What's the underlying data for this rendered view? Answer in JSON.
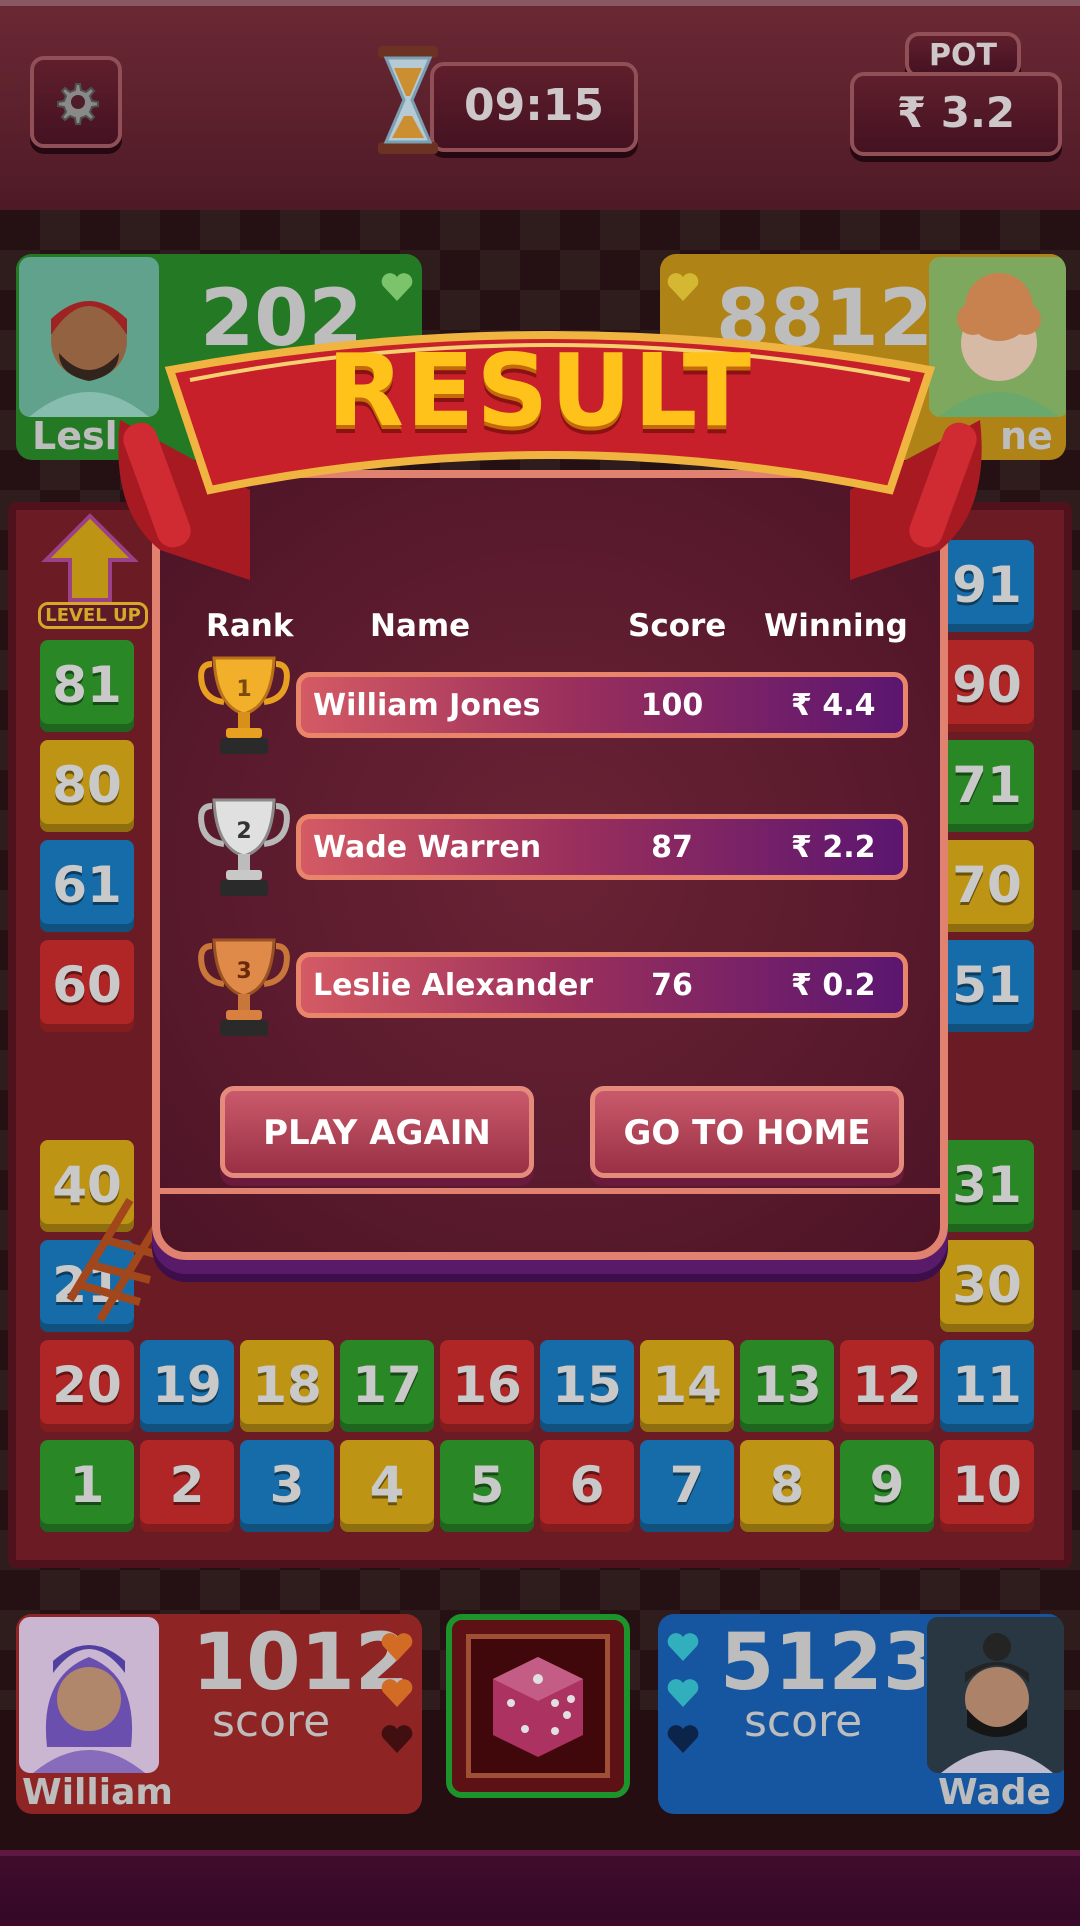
{
  "header": {
    "timer": "09:15",
    "pot_label": "POT",
    "pot_value": "₹ 3.2",
    "icons": [
      "gear-icon",
      "hourglass-icon"
    ]
  },
  "players_top": [
    {
      "name": "Leslie",
      "name_visible": "Lesl",
      "score": "202",
      "hearts": 1,
      "color": "#2f9a2c"
    },
    {
      "name_visible": "ne",
      "score": "8812",
      "hearts": 1,
      "color": "#d9a918"
    }
  ],
  "players_bottom": [
    {
      "name": "William",
      "score": "1012",
      "score_label": "score",
      "hearts_full": 2,
      "hearts_empty": 1,
      "color": "#c92c2c"
    },
    {
      "name": "Wade",
      "score": "5123",
      "score_label": "score",
      "hearts_full": 2,
      "hearts_empty": 1,
      "color": "#1a6cc0"
    }
  ],
  "board": {
    "level_up_label": "LEVEL UP",
    "tiles": [
      {
        "n": "1",
        "c": "green"
      },
      {
        "n": "2",
        "c": "red"
      },
      {
        "n": "3",
        "c": "blue"
      },
      {
        "n": "4",
        "c": "yellow"
      },
      {
        "n": "5",
        "c": "green"
      },
      {
        "n": "6",
        "c": "red"
      },
      {
        "n": "7",
        "c": "blue"
      },
      {
        "n": "8",
        "c": "yellow"
      },
      {
        "n": "9",
        "c": "green"
      },
      {
        "n": "10",
        "c": "red"
      },
      {
        "n": "20",
        "c": "red"
      },
      {
        "n": "19",
        "c": "blue"
      },
      {
        "n": "18",
        "c": "yellow"
      },
      {
        "n": "17",
        "c": "green"
      },
      {
        "n": "16",
        "c": "red"
      },
      {
        "n": "15",
        "c": "blue"
      },
      {
        "n": "14",
        "c": "yellow"
      },
      {
        "n": "13",
        "c": "green"
      },
      {
        "n": "12",
        "c": "red"
      },
      {
        "n": "11",
        "c": "blue"
      },
      {
        "n": "21",
        "c": "blue"
      },
      {
        "n": "30",
        "c": "yellow"
      },
      {
        "n": "40",
        "c": "yellow"
      },
      {
        "n": "31",
        "c": "green"
      },
      {
        "n": "60",
        "c": "red"
      },
      {
        "n": "51",
        "c": "blue"
      },
      {
        "n": "61",
        "c": "blue"
      },
      {
        "n": "70",
        "c": "yellow"
      },
      {
        "n": "80",
        "c": "yellow"
      },
      {
        "n": "71",
        "c": "green"
      },
      {
        "n": "81",
        "c": "green"
      },
      {
        "n": "90",
        "c": "red"
      },
      {
        "n": "91",
        "c": "blue"
      }
    ]
  },
  "result": {
    "title": "RESULT",
    "columns": {
      "rank": "Rank",
      "name": "Name",
      "score": "Score",
      "winning": "Winning"
    },
    "rows": [
      {
        "rank": "1",
        "name": "William Jones",
        "score": "100",
        "winning": "₹ 4.4",
        "trophy": "gold-trophy-icon"
      },
      {
        "rank": "2",
        "name": "Wade Warren",
        "score": "87",
        "winning": "₹ 2.2",
        "trophy": "silver-trophy-icon"
      },
      {
        "rank": "3",
        "name": "Leslie Alexander",
        "score": "76",
        "winning": "₹ 0.2",
        "trophy": "bronze-trophy-icon"
      }
    ],
    "buttons": {
      "play_again": "PLAY AGAIN",
      "go_home": "GO TO HOME"
    }
  },
  "colors": {
    "gold": "#ffc21a",
    "pill_border": "#e8856a",
    "panel": "#5a1a2d"
  }
}
